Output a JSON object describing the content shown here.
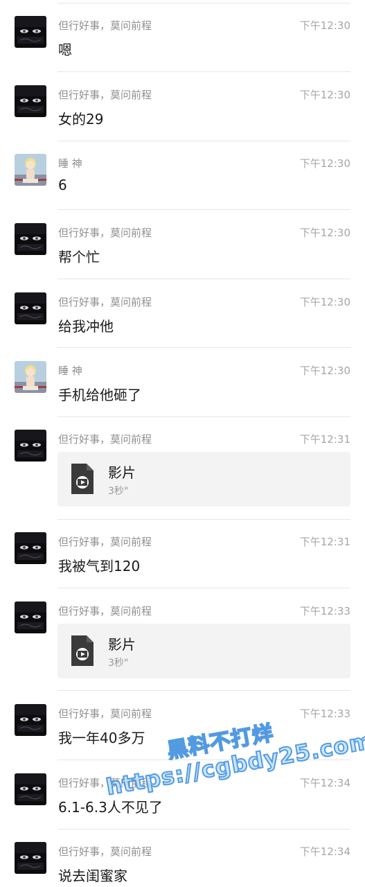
{
  "messages": [
    {
      "sender": "但行好事，莫问前程",
      "avatar": "dark-hair-avatar",
      "time": "下午12:30",
      "text": "嗯"
    },
    {
      "sender": "但行好事，莫问前程",
      "avatar": "dark-hair-avatar",
      "time": "下午12:30",
      "text": "女的29"
    },
    {
      "sender": "睡 神",
      "avatar": "anime-child-avatar",
      "time": "下午12:30",
      "text": "6"
    },
    {
      "sender": "但行好事，莫问前程",
      "avatar": "dark-hair-avatar",
      "time": "下午12:30",
      "text": "帮个忙"
    },
    {
      "sender": "但行好事，莫问前程",
      "avatar": "dark-hair-avatar",
      "time": "下午12:30",
      "text": "给我冲他"
    },
    {
      "sender": "睡 神",
      "avatar": "anime-child-avatar",
      "time": "下午12:30",
      "text": "手机给他砸了"
    },
    {
      "sender": "但行好事，莫问前程",
      "avatar": "dark-hair-avatar",
      "time": "下午12:31",
      "video": {
        "title": "影片",
        "duration": "3秒\""
      }
    },
    {
      "sender": "但行好事，莫问前程",
      "avatar": "dark-hair-avatar",
      "time": "下午12:31",
      "text": "我被气到120"
    },
    {
      "sender": "但行好事，莫问前程",
      "avatar": "dark-hair-avatar",
      "time": "下午12:33",
      "video": {
        "title": "影片",
        "duration": "3秒\""
      }
    },
    {
      "sender": "但行好事，莫问前程",
      "avatar": "dark-hair-avatar",
      "time": "下午12:33",
      "text": "我一年40多万"
    },
    {
      "sender": "但行好事，莫问前程",
      "avatar": "dark-hair-avatar",
      "time": "下午12:34",
      "text": "6.1-6.3人不见了"
    },
    {
      "sender": "但行好事，莫问前程",
      "avatar": "dark-hair-avatar",
      "time": "下午12:34",
      "text": "说去闺蜜家"
    }
  ],
  "watermark": {
    "line1": "黑料不打烊",
    "line2": "https://cgbdy25.com"
  },
  "colors": {
    "sender": "#8f8f8f",
    "time": "#a6a6a6",
    "text": "#1a1a1a",
    "divider": "#e6e6e6",
    "video_card": "#f3f3f3",
    "watermark_fill": "#bee2ff",
    "watermark_stroke": "#3c8cdc"
  }
}
